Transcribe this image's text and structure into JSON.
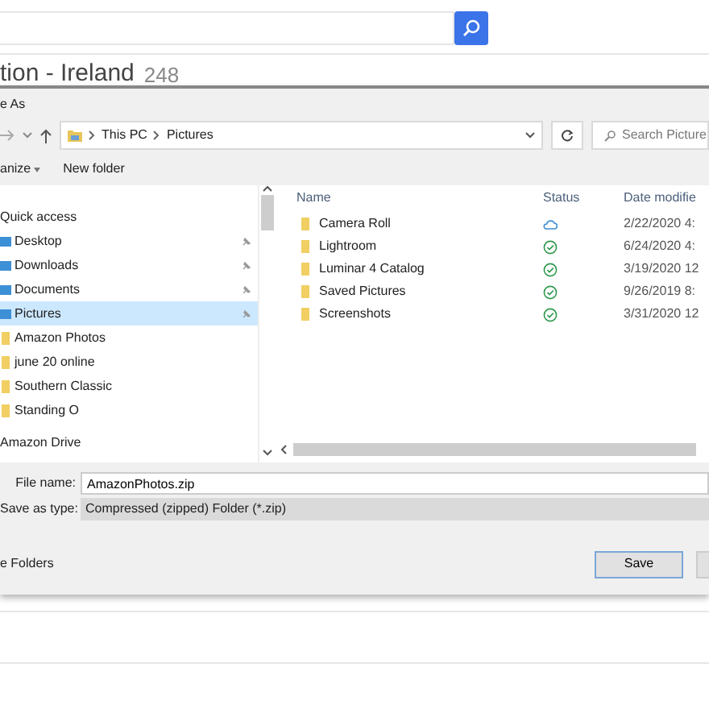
{
  "page": {
    "heading": "tion - Ireland",
    "count": "248"
  },
  "dialog": {
    "title": "e As",
    "address": {
      "crumbs": [
        "This PC",
        "Pictures"
      ]
    },
    "search": {
      "placeholder": "Search Picture"
    },
    "toolbar": [
      {
        "label": "anize",
        "menu": true
      },
      {
        "label": "New folder",
        "menu": false
      }
    ],
    "nav": [
      {
        "label": "Quick access",
        "kind": "section",
        "pinned": false,
        "selected": false
      },
      {
        "label": "Desktop",
        "kind": "library",
        "pinned": true,
        "selected": false
      },
      {
        "label": "Downloads",
        "kind": "library",
        "pinned": true,
        "selected": false
      },
      {
        "label": "Documents",
        "kind": "library",
        "pinned": true,
        "selected": false
      },
      {
        "label": "Pictures",
        "kind": "library",
        "pinned": true,
        "selected": true
      },
      {
        "label": "Amazon Photos",
        "kind": "folder",
        "pinned": false,
        "selected": false
      },
      {
        "label": "june 20 online",
        "kind": "folder",
        "pinned": false,
        "selected": false
      },
      {
        "label": "Southern Classic",
        "kind": "folder",
        "pinned": false,
        "selected": false
      },
      {
        "label": "Standing O",
        "kind": "folder",
        "pinned": false,
        "selected": false
      },
      {
        "label": "Amazon Drive",
        "kind": "section",
        "pinned": false,
        "selected": false
      }
    ],
    "columns": [
      "Name",
      "Status",
      "Date modifie"
    ],
    "files": [
      {
        "name": "Camera Roll",
        "synced": false,
        "date": "2/22/2020 4:"
      },
      {
        "name": "Lightroom",
        "synced": true,
        "date": "6/24/2020 4:"
      },
      {
        "name": "Luminar 4 Catalog",
        "synced": true,
        "date": "3/19/2020 12"
      },
      {
        "name": "Saved Pictures",
        "synced": true,
        "date": "9/26/2019 8:"
      },
      {
        "name": "Screenshots",
        "synced": true,
        "date": "3/31/2020 12"
      }
    ],
    "file_name": {
      "label": "File name:",
      "value": "AmazonPhotos.zip"
    },
    "save_type": {
      "label": "Save as type:",
      "value": "Compressed (zipped) Folder (*.zip)"
    },
    "hide_folders": "e Folders",
    "save_button": "Save"
  }
}
